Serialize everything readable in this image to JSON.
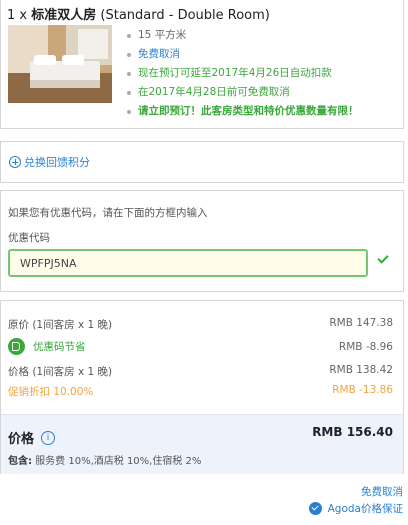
{
  "room": {
    "quantity": "1 x",
    "name": "标准双人房",
    "name_en": "(Standard - Double Room)",
    "features": [
      {
        "text": "15 平方米",
        "tone": "gray"
      },
      {
        "text": "免费取消",
        "tone": "blue"
      },
      {
        "text": "现在预订可延至2017年4月26日自动扣款",
        "tone": "green"
      },
      {
        "text": "在2017年4月28日前可免费取消",
        "tone": "green"
      },
      {
        "text": "请立即预订！此客房类型和特价优惠数量有限！",
        "tone": "green-bold"
      }
    ]
  },
  "points": {
    "label": "兑换回馈积分"
  },
  "promo": {
    "hint": "如果您有优惠代码，请在下面的方框内输入",
    "label": "优惠代码",
    "value": "WPFPJ5NA"
  },
  "pricing": {
    "original_label": "原价 (1间客房 x 1 晚)",
    "original_value": "RMB 147.38",
    "discount_label": "优惠码节省",
    "discount_value": "RMB -8.96",
    "price_label": "价格 (1间客房 x 1 晚)",
    "price_value": "RMB 138.42",
    "promo_label": "促销折扣 10.00%",
    "promo_value": "RMB -13.86",
    "total_label": "价格",
    "total_value": "RMB 156.40",
    "tax_prefix": "包含:",
    "tax_detail": "服务费 10%,酒店税 10%,住宿税 2%"
  },
  "footer": {
    "free_cancel": "免费取消",
    "guarantee": "Agoda价格保证"
  },
  "colors": {
    "accent_blue": "#2a7fd4",
    "success_green": "#3aa83a",
    "promo_orange": "#f5a23c",
    "total_bg": "#eef2fb"
  }
}
